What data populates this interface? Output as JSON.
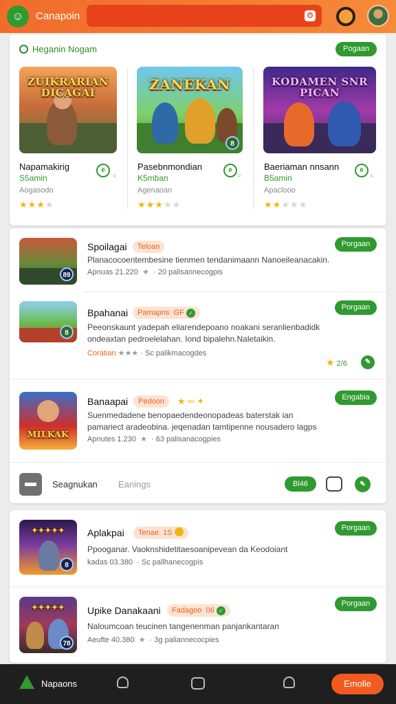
{
  "header": {
    "app_name": "Canapoin",
    "search_icon": "search-icon",
    "accent": "#f26b2a"
  },
  "featured": {
    "heading": "Heganin Nogam",
    "action_label": "Pogaan",
    "items": [
      {
        "art_title": "ZUIKRARIAN DICAGAI",
        "title": "Napamakirig",
        "subtitle": "S5amin",
        "developer": "Aogasodo",
        "icon": "e",
        "rating": 3
      },
      {
        "art_title": "ZANEKAN",
        "title": "Pasebnmondian",
        "subtitle": "K5mban",
        "developer": "Agenaoan",
        "icon": "e",
        "rating": 3
      },
      {
        "art_title": "KODAMEN SNR PICAN",
        "title": "Baeriaman nnsann",
        "subtitle": "B5amin",
        "developer": "Apaclooo",
        "icon": "e",
        "rating": 2
      }
    ]
  },
  "list1": [
    {
      "title": "Spoilagai",
      "tag": "Teloan",
      "desc1": "Planacocoentembesine tienmen tendanimaann Nanoeileanacakin.",
      "desc2": "",
      "meta": "Apnuas 21.220",
      "meta2": "20 palisannecogpis",
      "action": "Porgaan",
      "badge": "89"
    },
    {
      "title": "Bpahanai",
      "tag": "Pamapns",
      "tag_extra": "GF",
      "desc1": "Peeonskaunt yadepah eliarendepoano noakani seranlienbadidk",
      "desc2": "ondeaxtan pedroelelahan. Iond bipalehn.Naletaikin.",
      "meta": "Coratian",
      "meta2": "Sc palikmacogdes",
      "action": "Porgaan",
      "score": "2/6",
      "badge": "8"
    },
    {
      "title": "Banaapai",
      "tag": "Pedoon",
      "desc1": "Suenmedadene benopaedendeonopadeas baterstak ian",
      "desc2": "pamariect aradeobina. jeqenadan tamtipenne nousadero lagps",
      "meta": "Apnutes 1.230",
      "meta2": "63 palisanacogpies",
      "action": "Engabia",
      "badge": "MILKAK"
    }
  ],
  "toolbar": {
    "label1": "Seagnukan",
    "label2": "Eanings",
    "pill": "Bl46"
  },
  "list2": [
    {
      "title": "Aplakpai",
      "tag": "Tenae",
      "tag_extra": "1S",
      "desc1": "Ppooganar. Vaoknshidetitaesoanipevean da Keodoiant",
      "meta": "kadas 03.380",
      "meta2": "Sc pallhanecogpis",
      "action": "Porgaan",
      "badge": "8"
    },
    {
      "title": "Upike Danakaani",
      "tag": "Fadagoo",
      "tag_extra": "06",
      "desc1": "Naloumcoan teucinen tangenenman panjankantaran",
      "meta": "Aeufte 40.380",
      "meta2": "3g paliannecocpies",
      "action": "Porgaan",
      "badge": "78"
    }
  ],
  "bottom_nav": {
    "home_label": "Napaons",
    "cta_label": "Emolle"
  }
}
